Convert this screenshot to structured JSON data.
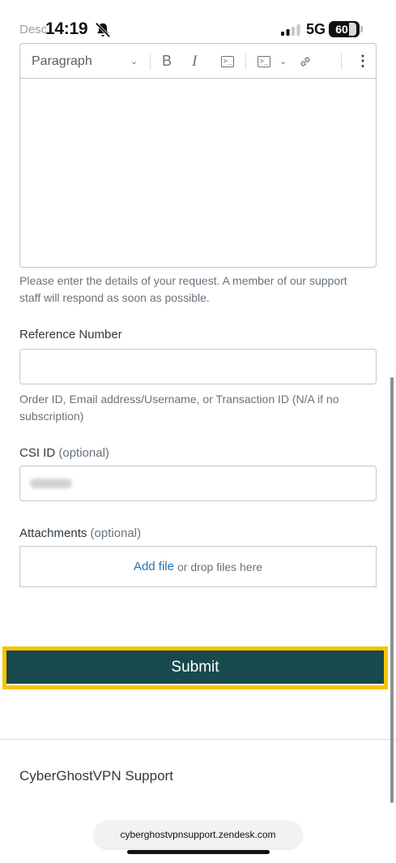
{
  "status_bar": {
    "behind_text": "Desc",
    "time": "14:19",
    "network": "5G",
    "battery": "60"
  },
  "editor": {
    "block_style": "Paragraph",
    "bold_label": "B",
    "italic_label": "I",
    "more_label": "⋮"
  },
  "description_help": "Please enter the details of your request. A member of our support staff will respond as soon as possible.",
  "reference": {
    "label": "Reference Number",
    "value": "",
    "help": "Order ID, Email address/Username, or Transaction ID (N/A if no subscription)"
  },
  "csi": {
    "label": "CSI ID",
    "optional": "(optional)"
  },
  "attachments": {
    "label": "Attachments",
    "optional": "(optional)",
    "add_file": "Add file",
    "drop_text": "or drop files here"
  },
  "submit_label": "Submit",
  "footer": {
    "brand": "CyberGhostVPN Support"
  },
  "browser": {
    "url": "cyberghostvpnsupport.zendesk.com"
  },
  "colors": {
    "submit_bg": "#17494d",
    "highlight": "#f5c400",
    "link": "#1f73b7"
  }
}
